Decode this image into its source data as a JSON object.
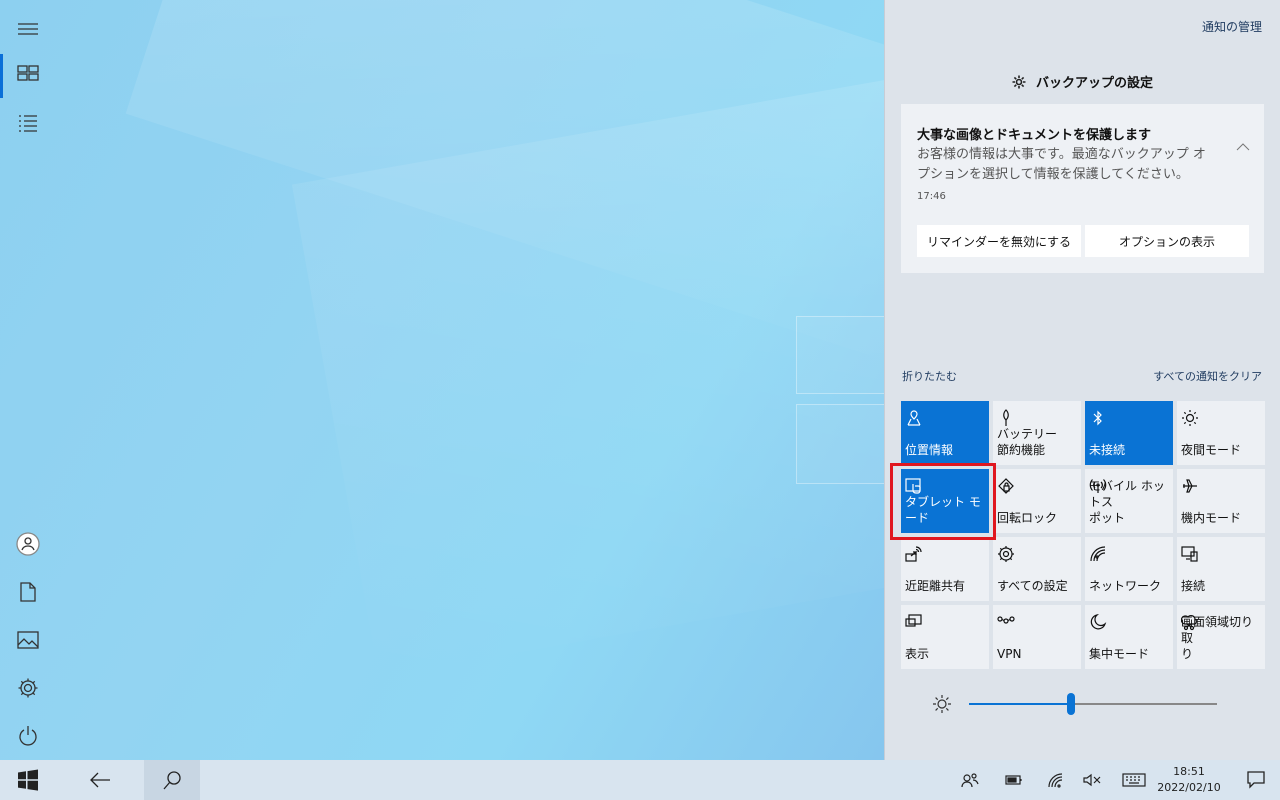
{
  "action_center": {
    "manage_link": "通知の管理",
    "group_title": "バックアップの設定",
    "group_icon": "gear-icon",
    "notification": {
      "title": "大事な画像とドキュメントを保護します",
      "body": "お客様の情報は大事です。最適なバックアップ オプションを選択して情報を保護してください。",
      "time": "17:46",
      "buttons": [
        "リマインダーを無効にする",
        "オプションの表示"
      ]
    },
    "collapse_link": "折りたたむ",
    "clear_all_link": "すべての通知をクリア",
    "tiles": [
      {
        "label": "位置情報",
        "icon": "location-icon",
        "active": true
      },
      {
        "label": "バッテリー\n節約機能",
        "icon": "battery-saver-icon",
        "active": false
      },
      {
        "label": "未接続",
        "icon": "bluetooth-icon",
        "active": true
      },
      {
        "label": "夜間モード",
        "icon": "night-light-icon",
        "active": false
      },
      {
        "label": "タブレット モード",
        "icon": "tablet-mode-icon",
        "active": true
      },
      {
        "label": "回転ロック",
        "icon": "rotation-lock-icon",
        "active": false
      },
      {
        "label": "モバイル ホットス\nポット",
        "icon": "mobile-hotspot-icon",
        "active": false
      },
      {
        "label": "機内モード",
        "icon": "airplane-icon",
        "active": false
      },
      {
        "label": "近距離共有",
        "icon": "nearby-share-icon",
        "active": false
      },
      {
        "label": "すべての設定",
        "icon": "settings-icon",
        "active": false
      },
      {
        "label": "ネットワーク",
        "icon": "network-icon",
        "active": false
      },
      {
        "label": "接続",
        "icon": "connect-icon",
        "active": false
      },
      {
        "label": "表示",
        "icon": "project-icon",
        "active": false
      },
      {
        "label": "VPN",
        "icon": "vpn-icon",
        "active": false
      },
      {
        "label": "集中モード",
        "icon": "focus-assist-icon",
        "active": false
      },
      {
        "label": "画面領域切り取\nり",
        "icon": "screen-snip-icon",
        "active": false
      }
    ],
    "brightness_level": 0.41
  },
  "taskbar": {
    "time": "18:51",
    "date": "2022/02/10"
  },
  "colors": {
    "accent": "#0a73d4",
    "highlight": "#e0171f"
  }
}
